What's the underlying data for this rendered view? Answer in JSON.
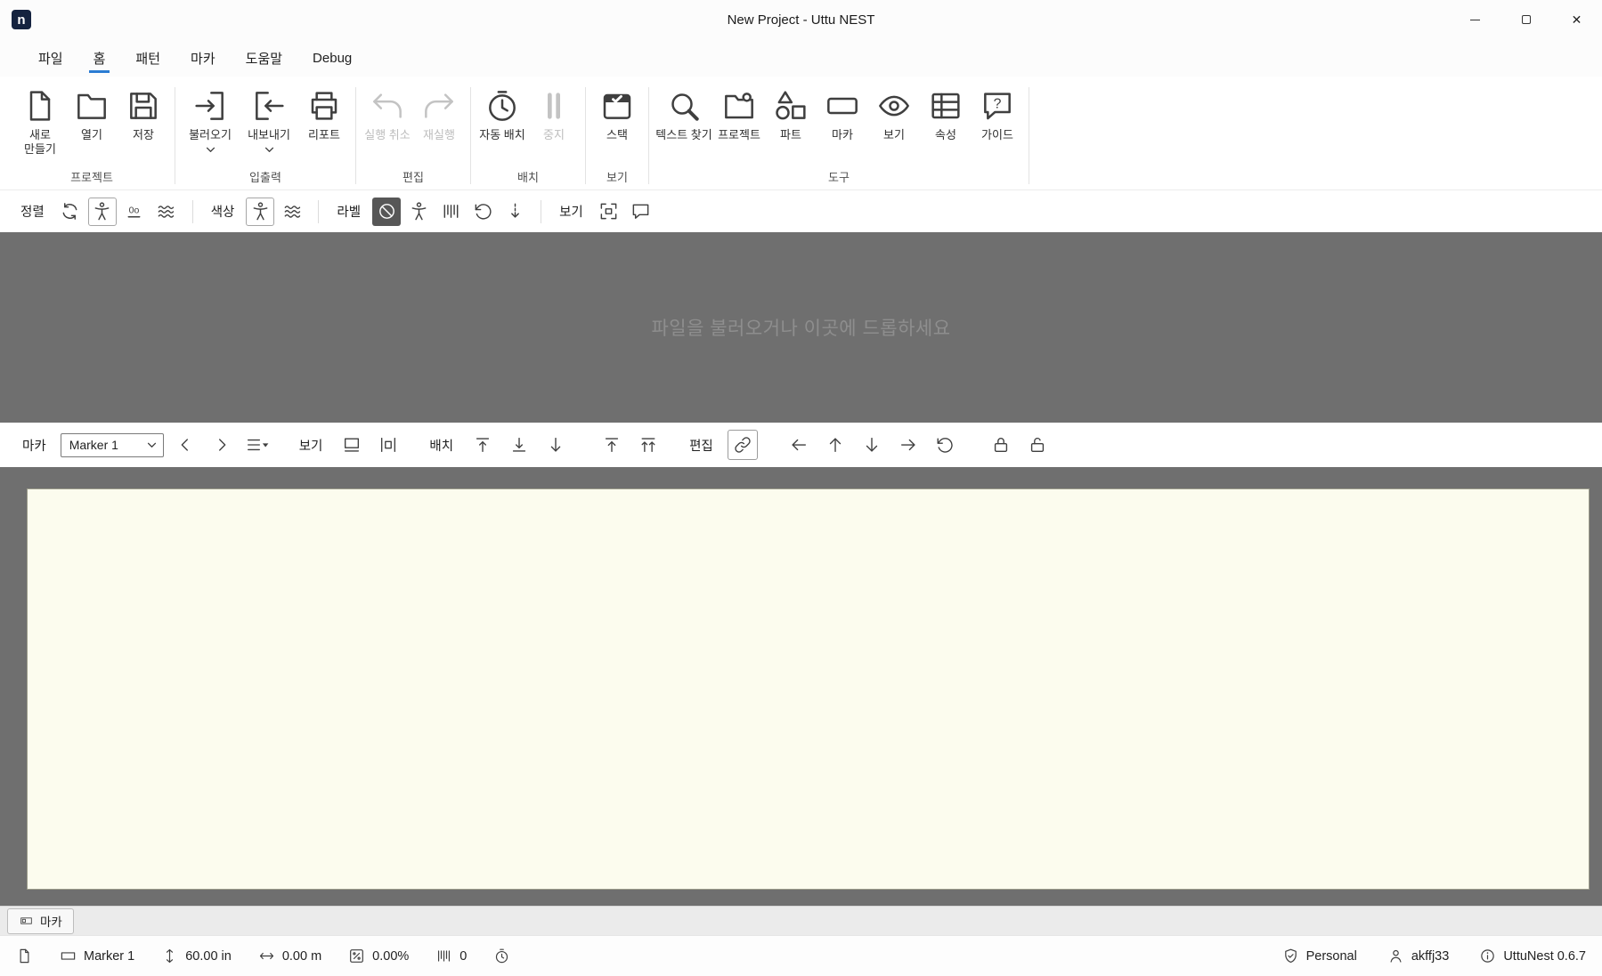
{
  "colors": {
    "accent": "#2b7cd3",
    "logo-bg": "#15233f",
    "work-bg": "#6f6f6f",
    "sheet-bg": "#fcfcee"
  },
  "window": {
    "title": "New Project - Uttu NEST",
    "logo_letter": "n"
  },
  "menubar": {
    "items": [
      {
        "label": "파일"
      },
      {
        "label": "홈"
      },
      {
        "label": "패턴"
      },
      {
        "label": "마카"
      },
      {
        "label": "도움말"
      },
      {
        "label": "Debug"
      }
    ]
  },
  "ribbon": {
    "groups": [
      {
        "label": "프로젝트",
        "buttons": [
          {
            "label": "새로 만들기"
          },
          {
            "label": "열기"
          },
          {
            "label": "저장"
          }
        ]
      },
      {
        "label": "입출력",
        "buttons": [
          {
            "label": "불러오기",
            "dropdown": true
          },
          {
            "label": "내보내기",
            "dropdown": true
          },
          {
            "label": "리포트"
          }
        ]
      },
      {
        "label": "편집",
        "buttons": [
          {
            "label": "실행 취소",
            "disabled": true
          },
          {
            "label": "재실행",
            "disabled": true
          }
        ]
      },
      {
        "label": "배치",
        "buttons": [
          {
            "label": "자동 배치"
          },
          {
            "label": "중지",
            "disabled": true
          }
        ]
      },
      {
        "label": "보기",
        "buttons": [
          {
            "label": "스택"
          }
        ]
      },
      {
        "label": "도구",
        "buttons": [
          {
            "label": "텍스트 찾기"
          },
          {
            "label": "프로젝트"
          },
          {
            "label": "파트"
          },
          {
            "label": "마카"
          },
          {
            "label": "보기"
          },
          {
            "label": "속성"
          },
          {
            "label": "가이드"
          }
        ]
      }
    ]
  },
  "align_toolbar": {
    "sort_label": "정렬",
    "color_label": "색상",
    "label_label": "라벨",
    "view_label": "보기"
  },
  "pattern_area": {
    "drop_hint": "파일을 불러오거나 이곳에 드롭하세요"
  },
  "marker_toolbar": {
    "marker_label": "마카",
    "marker_select_value": "Marker 1",
    "view_label": "보기",
    "place_label": "배치",
    "edit_label": "편집"
  },
  "tabbar": {
    "tabs": [
      {
        "label": "마카"
      }
    ]
  },
  "statusbar": {
    "marker_name": "Marker 1",
    "marker_length": "60.00 in",
    "marker_width": "0.00 m",
    "efficiency": "0.00%",
    "part_count": "0",
    "license": "Personal",
    "username": "akffj33",
    "version": "UttuNest 0.6.7"
  },
  "icons": {
    "minimize": "─",
    "maximize": "▢",
    "close": "✕",
    "dropdown_caret": "▾",
    "question_mark": "?",
    "text_sample": "0o"
  }
}
